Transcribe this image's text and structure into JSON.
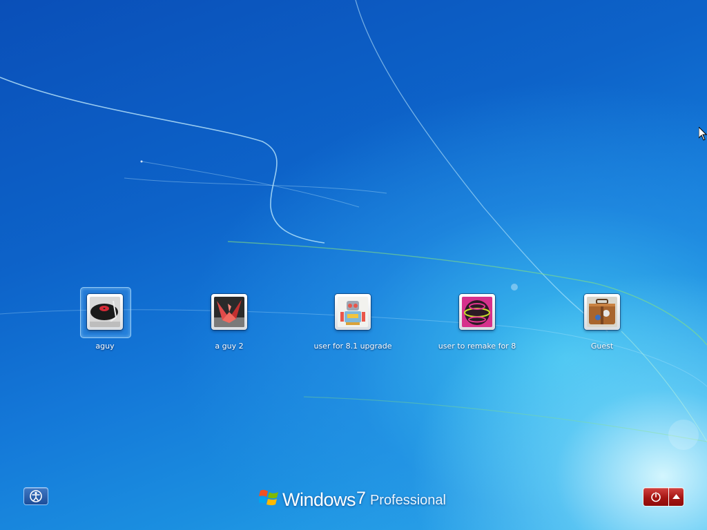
{
  "users": [
    {
      "name": "aguy",
      "picture": "turntable-icon",
      "selected": true
    },
    {
      "name": "a guy 2",
      "picture": "paper-crane-icon",
      "selected": false
    },
    {
      "name": "user for 8.1 upgrade",
      "picture": "robot-icon",
      "selected": false
    },
    {
      "name": "user to remake for 8",
      "picture": "ball-icon",
      "selected": false
    },
    {
      "name": "Guest",
      "picture": "suitcase-icon",
      "selected": false
    }
  ],
  "branding": {
    "word": "Windows",
    "version": "7",
    "edition": "Professional"
  },
  "icons": {
    "ease_of_access": "ease-of-access-icon",
    "power": "power-icon",
    "shutdown_options": "chevron-up-icon",
    "pointer": "mouse-pointer-icon"
  },
  "colors": {
    "background_deep": "#0a4fb8",
    "background_light": "#31b3ee",
    "power_button": "#a51512",
    "label_text": "#ffffff"
  }
}
